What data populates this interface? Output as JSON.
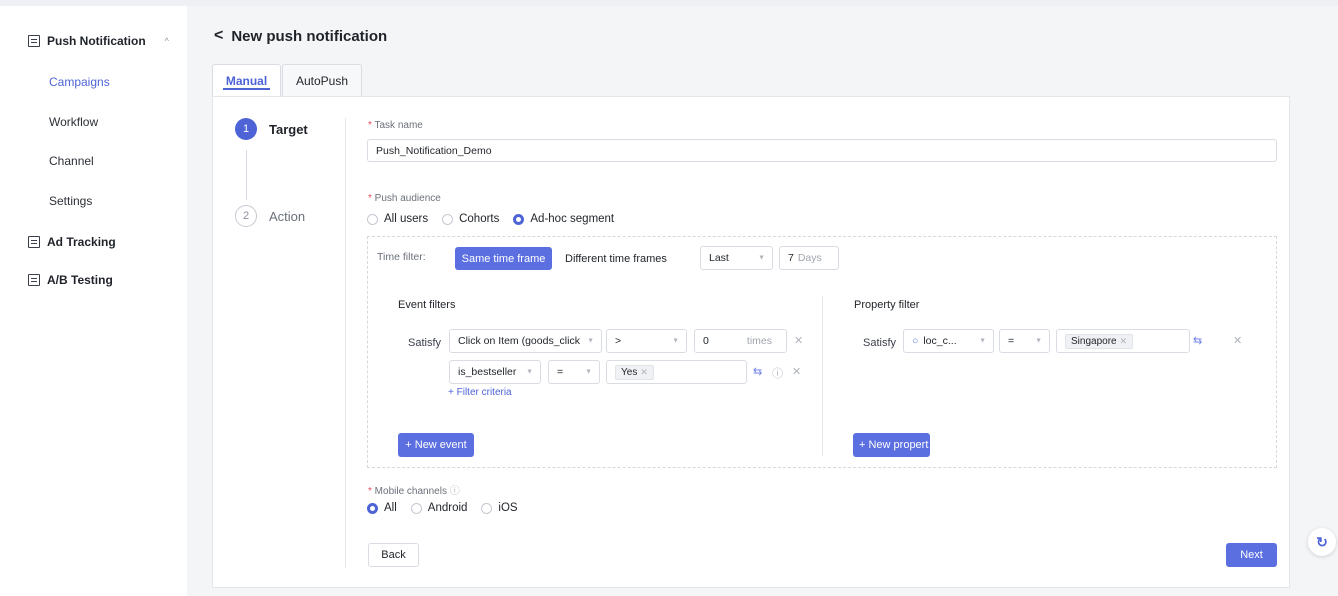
{
  "sidebar": {
    "groups": [
      {
        "label": "Push Notification",
        "expanded": true
      },
      {
        "label": "Ad Tracking"
      },
      {
        "label": "A/B Testing"
      }
    ],
    "items": [
      {
        "label": "Campaigns",
        "active": true
      },
      {
        "label": "Workflow"
      },
      {
        "label": "Channel"
      },
      {
        "label": "Settings"
      }
    ]
  },
  "header": {
    "title": "New push notification"
  },
  "tabs": [
    {
      "label": "Manual",
      "active": true
    },
    {
      "label": "AutoPush"
    }
  ],
  "steps": [
    {
      "num": "1",
      "label": "Target"
    },
    {
      "num": "2",
      "label": "Action"
    }
  ],
  "form": {
    "task_name_label": "Task name",
    "task_name_value": "Push_Notification_Demo",
    "audience_label": "Push audience",
    "audience_options": [
      "All users",
      "Cohorts",
      "Ad-hoc segment"
    ],
    "audience_selected": "Ad-hoc segment",
    "time_filter_label": "Time filter:",
    "time_same": "Same time frame",
    "time_different": "Different time frames",
    "time_last": "Last",
    "time_days_num": "7",
    "time_days_unit": "Days",
    "event_filters_title": "Event filters",
    "satisfy": "Satisfy",
    "event_name": "Click on Item (goods_click",
    "event_op": ">",
    "event_count": "0",
    "event_unit": "times",
    "sub_prop": "is_bestseller",
    "sub_op": "=",
    "sub_val": "Yes",
    "filter_criteria": "+ Filter criteria",
    "new_event": "+ New event",
    "property_filter_title": "Property filter",
    "prop_satisfy": "Satisfy",
    "prop_name": "loc_c...",
    "prop_op": "=",
    "prop_val": "Singapore",
    "new_property": "+ New propert",
    "mobile_channels_label": "Mobile channels",
    "channel_options": [
      "All",
      "Android",
      "iOS"
    ],
    "channel_selected": "All"
  },
  "buttons": {
    "back": "Back",
    "next": "Next"
  },
  "colors": {
    "accent": "#4e63d6",
    "required": "#e34d59"
  }
}
